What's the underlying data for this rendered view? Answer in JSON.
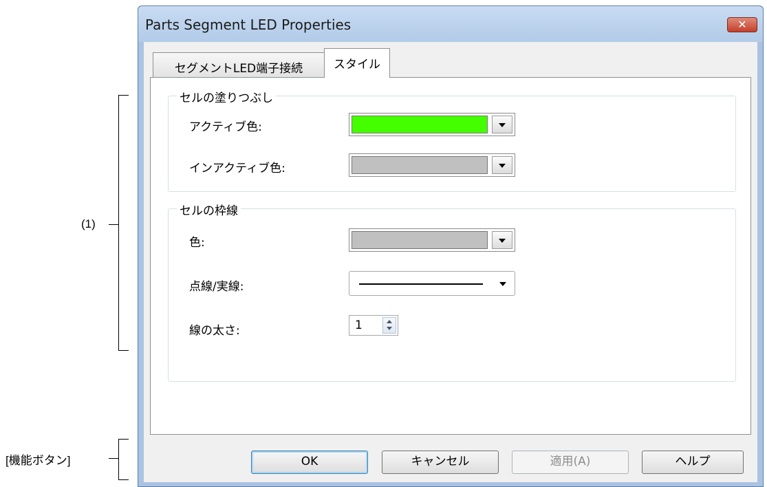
{
  "annotations": {
    "section": "(1)",
    "function_buttons": "[機能ボタン]"
  },
  "dialog": {
    "title": "Parts Segment LED Properties",
    "close_symbol": "✕",
    "tabs": [
      {
        "label": "セグメントLED端子接続",
        "active": false
      },
      {
        "label": "スタイル",
        "active": true
      }
    ],
    "fill_group": {
      "title": "セルの塗りつぶし",
      "active_color": {
        "label": "アクティブ色:",
        "color": "#44ff00"
      },
      "inactive_color": {
        "label": "インアクティブ色:",
        "color": "#c0c0c0"
      }
    },
    "border_group": {
      "title": "セルの枠線",
      "color": {
        "label": "色:",
        "color": "#c0c0c0"
      },
      "line_style": {
        "label": "点線/実線:"
      },
      "line_width": {
        "label": "線の太さ:",
        "value": "1"
      }
    },
    "buttons": {
      "ok": "OK",
      "cancel": "キャンセル",
      "apply": "適用(A)",
      "help": "ヘルプ"
    }
  }
}
